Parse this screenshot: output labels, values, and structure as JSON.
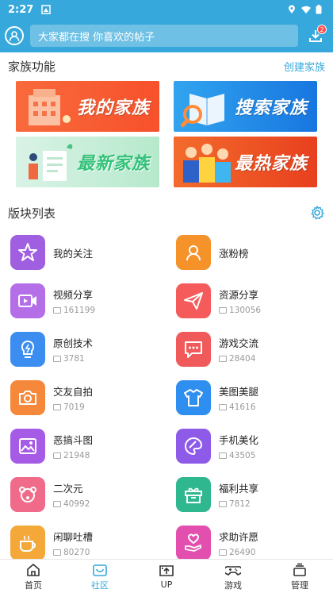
{
  "status": {
    "time": "2:27"
  },
  "search": {
    "placeholder": "大家都在搜  你喜欢的帖子",
    "badge": "2"
  },
  "family": {
    "title": "家族功能",
    "create_label": "创建家族",
    "banners": [
      "我的家族",
      "搜索家族",
      "最新家族",
      "最热家族"
    ]
  },
  "forums": {
    "title": "版块列表",
    "items": [
      {
        "name": "我的关注",
        "count": "",
        "icon": "star-icon",
        "color": "#a05ee0"
      },
      {
        "name": "涨粉榜",
        "count": "",
        "icon": "rank-icon",
        "color": "#f5922a"
      },
      {
        "name": "视频分享",
        "count": "161199",
        "icon": "video-icon",
        "color": "#b36ee8"
      },
      {
        "name": "资源分享",
        "count": "130056",
        "icon": "send-icon",
        "color": "#f55b5b"
      },
      {
        "name": "原创技术",
        "count": "3781",
        "icon": "bulb-icon",
        "color": "#3b8ef0"
      },
      {
        "name": "游戏交流",
        "count": "28404",
        "icon": "chat-icon",
        "color": "#f15a5a"
      },
      {
        "name": "交友自拍",
        "count": "7019",
        "icon": "camera-icon",
        "color": "#f5883a"
      },
      {
        "name": "美图美腿",
        "count": "41616",
        "icon": "shirt-icon",
        "color": "#2f8ff0"
      },
      {
        "name": "恶搞斗图",
        "count": "21948",
        "icon": "image-icon",
        "color": "#a65be6"
      },
      {
        "name": "手机美化",
        "count": "43505",
        "icon": "palette-icon",
        "color": "#8e5ae8"
      },
      {
        "name": "二次元",
        "count": "40992",
        "icon": "bear-icon",
        "color": "#f06a8a"
      },
      {
        "name": "福利共享",
        "count": "7812",
        "icon": "gift-icon",
        "color": "#2fb890"
      },
      {
        "name": "闲聊吐槽",
        "count": "80270",
        "icon": "coffee-icon",
        "color": "#f5a83a"
      },
      {
        "name": "求助许愿",
        "count": "26490",
        "icon": "heart-hand-icon",
        "color": "#e24fae"
      }
    ]
  },
  "nav": [
    {
      "label": "首页",
      "icon": "home-icon"
    },
    {
      "label": "社区",
      "icon": "community-icon",
      "active": true
    },
    {
      "label": "UP",
      "icon": "up-icon"
    },
    {
      "label": "游戏",
      "icon": "gamepad-icon"
    },
    {
      "label": "管理",
      "icon": "manage-icon"
    }
  ],
  "colors": {
    "primary": "#36a8dc"
  }
}
